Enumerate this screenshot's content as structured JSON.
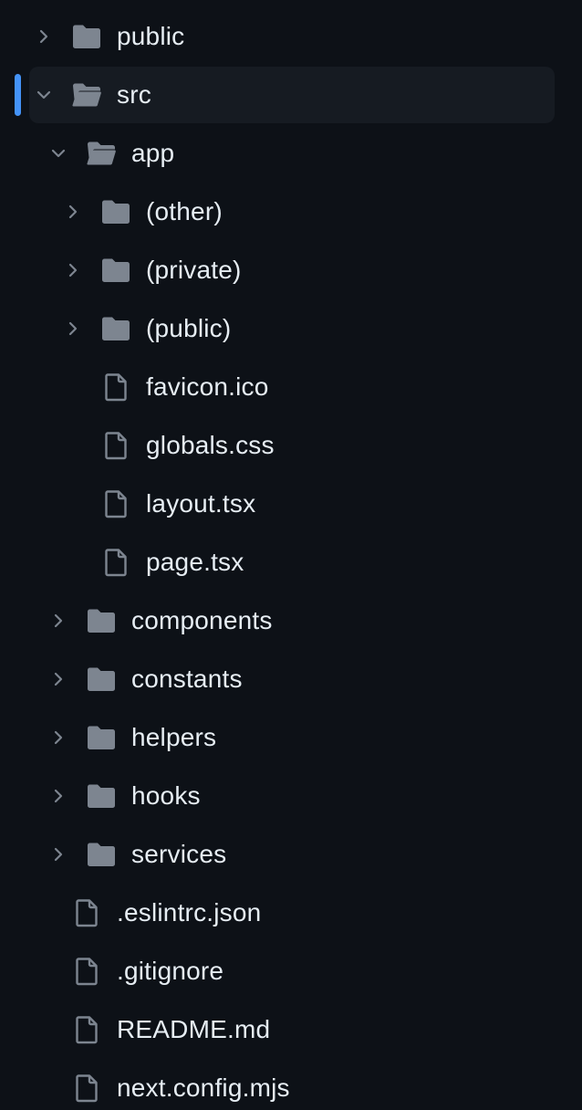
{
  "colors": {
    "background": "#0d1117",
    "selected_row": "#161b22",
    "accent": "#4493f8",
    "icon": "#7d8590",
    "text": "#e6edf3"
  },
  "tree": [
    {
      "label": "public",
      "type": "folder",
      "state": "collapsed",
      "depth": 0,
      "selected": false
    },
    {
      "label": "src",
      "type": "folder",
      "state": "expanded",
      "depth": 0,
      "selected": true
    },
    {
      "label": "app",
      "type": "folder",
      "state": "expanded",
      "depth": 1,
      "selected": false
    },
    {
      "label": "(other)",
      "type": "folder",
      "state": "collapsed",
      "depth": 2,
      "selected": false
    },
    {
      "label": "(private)",
      "type": "folder",
      "state": "collapsed",
      "depth": 2,
      "selected": false
    },
    {
      "label": "(public)",
      "type": "folder",
      "state": "collapsed",
      "depth": 2,
      "selected": false
    },
    {
      "label": "favicon.ico",
      "type": "file",
      "depth": 2,
      "selected": false
    },
    {
      "label": "globals.css",
      "type": "file",
      "depth": 2,
      "selected": false
    },
    {
      "label": "layout.tsx",
      "type": "file",
      "depth": 2,
      "selected": false
    },
    {
      "label": "page.tsx",
      "type": "file",
      "depth": 2,
      "selected": false
    },
    {
      "label": "components",
      "type": "folder",
      "state": "collapsed",
      "depth": 1,
      "selected": false
    },
    {
      "label": "constants",
      "type": "folder",
      "state": "collapsed",
      "depth": 1,
      "selected": false
    },
    {
      "label": "helpers",
      "type": "folder",
      "state": "collapsed",
      "depth": 1,
      "selected": false
    },
    {
      "label": "hooks",
      "type": "folder",
      "state": "collapsed",
      "depth": 1,
      "selected": false
    },
    {
      "label": "services",
      "type": "folder",
      "state": "collapsed",
      "depth": 1,
      "selected": false
    },
    {
      "label": ".eslintrc.json",
      "type": "file",
      "depth": 0,
      "selected": false
    },
    {
      "label": ".gitignore",
      "type": "file",
      "depth": 0,
      "selected": false
    },
    {
      "label": "README.md",
      "type": "file",
      "depth": 0,
      "selected": false
    },
    {
      "label": "next.config.mjs",
      "type": "file",
      "depth": 0,
      "selected": false
    }
  ]
}
